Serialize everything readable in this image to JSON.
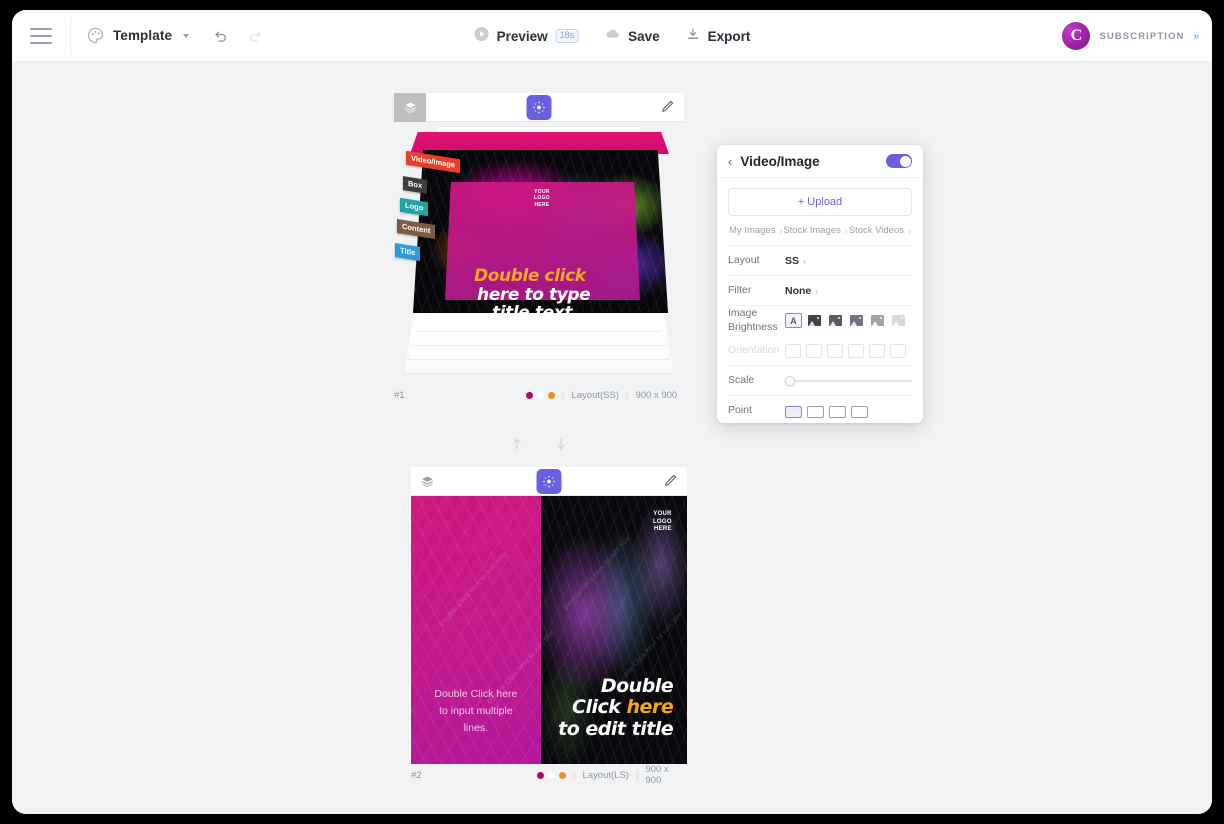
{
  "topbar": {
    "menu_icon": "hamburger-icon",
    "template_icon": "palette-icon",
    "template_label": "Template",
    "undo_icon": "undo-icon",
    "redo_icon": "redo-icon",
    "preview_label": "Preview",
    "preview_duration": "18s",
    "preview_icon": "play-icon",
    "save_label": "Save",
    "save_icon": "cloud-icon",
    "export_label": "Export",
    "export_icon": "download-icon",
    "avatar_letter": "C",
    "subscription_label": "SUBSCRIPTION",
    "subscription_arrows": "»",
    "accent_color": "#6a5fe0",
    "avatar_color": "#a31fa8"
  },
  "slides": [
    {
      "number": "#1",
      "layout": "Layout(SS)",
      "size": "900 x 900",
      "layers_icon": "layers-icon",
      "move_icon": "move-icon",
      "edit_icon": "pencil-icon",
      "dots": [
        "#a80c5c",
        "#ffffff",
        "#f08c20"
      ],
      "logo_text": "YOUR\nLOGO\nHERE",
      "headline_line1": "Double click",
      "headline_line2": "here to type",
      "headline_line3": "title text",
      "layer_tags": [
        {
          "label": "Video/Image",
          "color": "#e8402a"
        },
        {
          "label": "Box",
          "color": "#3d3d3d"
        },
        {
          "label": "Logo",
          "color": "#1fa3a3"
        },
        {
          "label": "Content",
          "color": "#7c5c45"
        },
        {
          "label": "Title",
          "color": "#2f9bdb"
        }
      ]
    },
    {
      "number": "#2",
      "layout": "Layout(LS)",
      "size": "900 x 900",
      "layers_icon": "layers-icon",
      "move_icon": "move-icon",
      "edit_icon": "pencil-icon",
      "dots": [
        "#a80c5c",
        "#ffffff",
        "#f08c20"
      ],
      "logo_text": "YOUR\nLOGO\nHERE",
      "body_text": "Double Click here to input multiple lines.",
      "title_line1": "Double",
      "title_line2a": "Click ",
      "title_line2b": "here",
      "title_line3": "to edit title",
      "watermark": "Double Click here to edit title"
    }
  ],
  "nav": {
    "up_icon": "arrow-up-icon",
    "down_icon": "arrow-down-icon"
  },
  "panel": {
    "back_icon": "chevron-left-icon",
    "title": "Video/Image",
    "toggle_on": true,
    "upload_label": "+ Upload",
    "sources": [
      {
        "label": "My Images"
      },
      {
        "label": "Stock Images"
      },
      {
        "label": "Stock Videos"
      }
    ],
    "rows": [
      {
        "label": "Layout",
        "value": "SS"
      },
      {
        "label": "Filter",
        "value": "None"
      }
    ],
    "brightness_label": "Image Brightness",
    "brightness_options": [
      "A",
      "",
      "",
      "",
      "",
      ""
    ],
    "brightness_selected_index": 0,
    "orientation_label": "Orientation",
    "scale_label": "Scale",
    "scale_value": 0,
    "point_label": "Point"
  }
}
